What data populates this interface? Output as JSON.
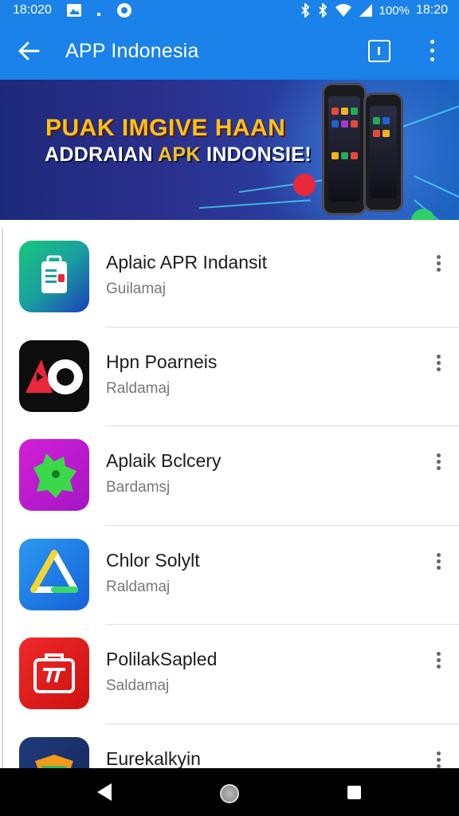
{
  "status_bar": {
    "time_left": "18:020",
    "battery": "100%",
    "time_right": "18:20"
  },
  "app_bar": {
    "title": "APP Indonesia",
    "back_icon": "arrow-left-icon",
    "info_icon": "info-square-icon",
    "more_icon": "more-vert-icon"
  },
  "banner": {
    "headline_line1": "PUAK IMGIVE HAAN",
    "headline_line2_prefix": "ADDRAIAN ",
    "headline_line2_highlight": "APK",
    "headline_line2_suffix": " INDONSIE!"
  },
  "apps": [
    {
      "name": "Aplaic APR Indansit",
      "subtitle": "Guilamaj",
      "icon": "briefcase-app-icon"
    },
    {
      "name": "Hpn Poarneis",
      "subtitle": "Raldamaj",
      "icon": "red-play-app-icon"
    },
    {
      "name": "Aplaik Bclcery",
      "subtitle": "Bardamsj",
      "icon": "green-monster-app-icon"
    },
    {
      "name": "Chlor Solylt",
      "subtitle": "Raldamaj",
      "icon": "triangle-app-icon"
    },
    {
      "name": "PolilakSapled",
      "subtitle": "Saldamaj",
      "icon": "red-bag-app-icon"
    },
    {
      "name": "Eurekalkyin",
      "subtitle": "",
      "icon": "folder-app-icon"
    }
  ],
  "colors": {
    "primary": "#1a82e8",
    "banner_yellow": "#f7c21c"
  },
  "nav_bar": {
    "back_icon": "nav-back-icon",
    "home_icon": "nav-home-icon",
    "recents_icon": "nav-recents-icon"
  }
}
